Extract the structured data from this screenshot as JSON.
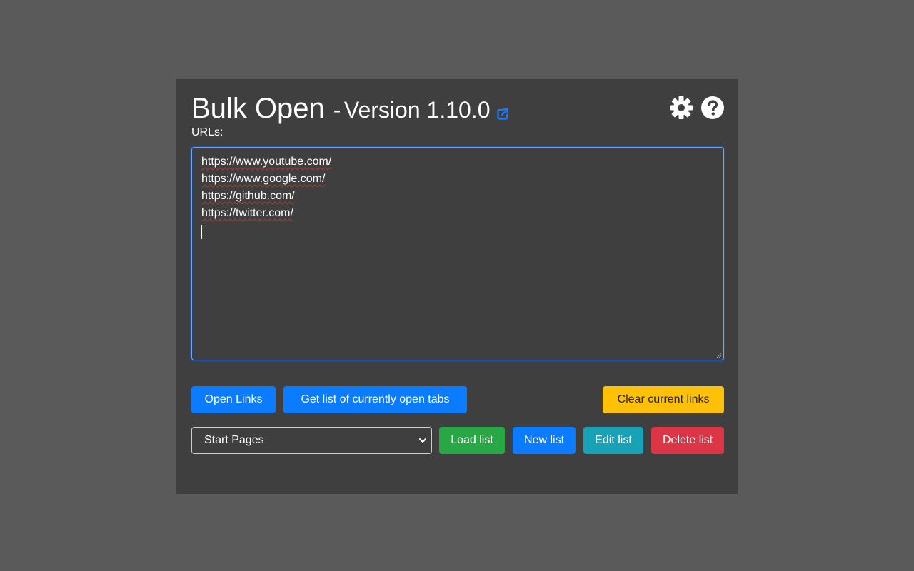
{
  "header": {
    "app_name": "Bulk Open",
    "version_separator": "-",
    "version_text": "Version 1.10.0",
    "icons": {
      "external_link": "external-link-icon",
      "settings": "gear-icon",
      "help": "question-circle-icon"
    }
  },
  "urls": {
    "label": "URLs:",
    "lines": [
      "https://www.youtube.com/",
      "https://www.google.com/",
      "https://github.com/",
      "https://twitter.com/"
    ]
  },
  "actions": {
    "open_links": "Open Links",
    "get_open_tabs": "Get list of currently open tabs",
    "clear_links": "Clear current links"
  },
  "lists": {
    "selected": "Start Pages",
    "load": "Load list",
    "new": "New list",
    "edit": "Edit list",
    "delete": "Delete list"
  },
  "colors": {
    "background": "#5a5a5a",
    "panel": "#3f3f3f",
    "primary": "#0b7bff",
    "warning": "#ffc107",
    "success": "#28a745",
    "info": "#17a2b8",
    "danger": "#dc3545"
  }
}
